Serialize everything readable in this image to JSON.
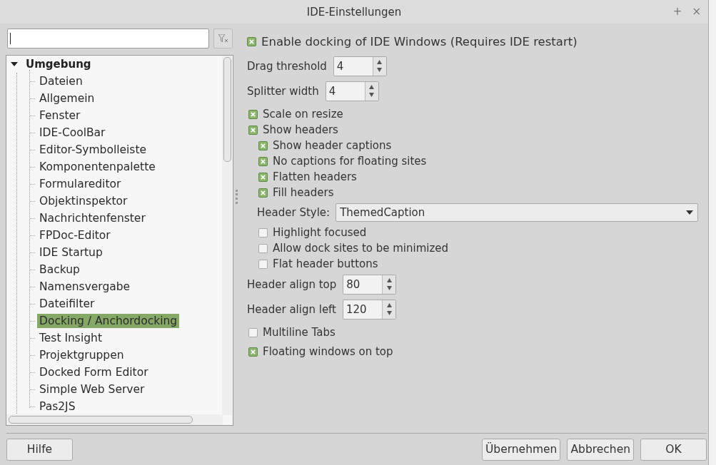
{
  "window": {
    "title": "IDE-Einstellungen",
    "controls": [
      "+",
      "×"
    ]
  },
  "tree": [
    {
      "label": "Umgebung",
      "expanded": true,
      "selected": false,
      "children": [
        {
          "label": "Dateien",
          "selected": false
        },
        {
          "label": "Allgemein",
          "selected": false
        },
        {
          "label": "Fenster",
          "selected": false
        },
        {
          "label": "IDE-CoolBar",
          "selected": false
        },
        {
          "label": "Editor-Symbolleiste",
          "selected": false
        },
        {
          "label": "Komponentenpalette",
          "selected": false
        },
        {
          "label": "Formulareditor",
          "selected": false
        },
        {
          "label": "Objektinspektor",
          "selected": false
        },
        {
          "label": "Nachrichtenfenster",
          "selected": false
        },
        {
          "label": "FPDoc-Editor",
          "selected": false
        },
        {
          "label": "IDE Startup",
          "selected": false
        },
        {
          "label": "Backup",
          "selected": false
        },
        {
          "label": "Namensvergabe",
          "selected": false
        },
        {
          "label": "Dateifilter",
          "selected": false
        },
        {
          "label": "Docking / Anchordocking",
          "selected": true
        },
        {
          "label": "Test Insight",
          "selected": false
        },
        {
          "label": "Projektgruppen",
          "selected": false
        },
        {
          "label": "Docked Form Editor",
          "selected": false
        },
        {
          "label": "Simple Web Server",
          "selected": false
        },
        {
          "label": "Pas2JS",
          "selected": false
        }
      ]
    }
  ],
  "header_option": {
    "label": "Enable docking of IDE Windows (Requires IDE restart)",
    "checked": true
  },
  "settings": [
    {
      "kind": "spin",
      "label": "Drag threshold",
      "value": "4"
    },
    {
      "kind": "spin",
      "label": "Splitter width",
      "value": "4"
    },
    {
      "kind": "check",
      "label": "Scale on resize",
      "checked": true
    },
    {
      "kind": "check",
      "label": "Show headers",
      "checked": true,
      "children": [
        {
          "kind": "check",
          "label": "Show header captions",
          "checked": true
        },
        {
          "kind": "check",
          "label": "No captions for floating sites",
          "checked": true
        },
        {
          "kind": "check",
          "label": "Flatten headers",
          "checked": true
        },
        {
          "kind": "check",
          "label": "Fill headers",
          "checked": true
        },
        {
          "kind": "select",
          "label": "Header Style:",
          "value": "ThemedCaption"
        },
        {
          "kind": "check",
          "label": "Highlight focused",
          "checked": false
        },
        {
          "kind": "check",
          "label": "Allow dock sites to be minimized",
          "checked": false
        },
        {
          "kind": "check",
          "label": "Flat header buttons",
          "checked": false
        }
      ]
    },
    {
      "kind": "spin",
      "label": "Header align top",
      "value": "80"
    },
    {
      "kind": "spin",
      "label": "Header align left",
      "value": "120"
    },
    {
      "kind": "check",
      "label": "Multiline Tabs",
      "checked": false
    },
    {
      "kind": "check",
      "label": "Floating windows on top",
      "checked": true
    }
  ],
  "buttons": {
    "left": [
      "Hilfe"
    ],
    "right": [
      "Übernehmen",
      "Abbrechen",
      "OK"
    ]
  }
}
